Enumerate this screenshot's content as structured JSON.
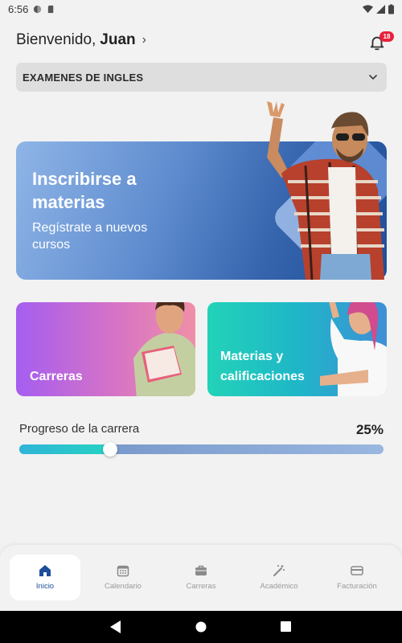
{
  "status_bar": {
    "time": "6:56"
  },
  "header": {
    "greeting": "Bienvenido,",
    "user_name": "Juan",
    "notification_count": "18"
  },
  "program_select": {
    "value": "EXAMENES DE INGLES"
  },
  "hero_card": {
    "title": "Inscribirse a materias",
    "subtitle": "Regístrate a nuevos cursos"
  },
  "cards": [
    {
      "label": "Carreras"
    },
    {
      "label": "Materias y calificaciones"
    }
  ],
  "progress": {
    "label": "Progreso de la carrera",
    "value_text": "25%",
    "fraction": 0.25
  },
  "bottom_nav": [
    {
      "label": "Inicio",
      "icon": "home-icon",
      "active": true
    },
    {
      "label": "Calendario",
      "icon": "calendar-icon",
      "active": false
    },
    {
      "label": "Carreras",
      "icon": "briefcase-icon",
      "active": false
    },
    {
      "label": "Académico",
      "icon": "magic-wand-icon",
      "active": false
    },
    {
      "label": "Facturación",
      "icon": "credit-card-icon",
      "active": false
    }
  ],
  "colors": {
    "accent": "#1d4e9a",
    "badge": "#e8203c"
  }
}
